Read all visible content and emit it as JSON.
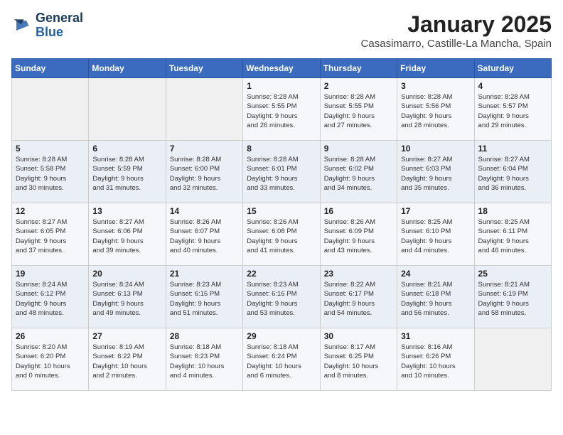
{
  "logo": {
    "line1": "General",
    "line2": "Blue"
  },
  "title": "January 2025",
  "location": "Casasimarro, Castille-La Mancha, Spain",
  "days_of_week": [
    "Sunday",
    "Monday",
    "Tuesday",
    "Wednesday",
    "Thursday",
    "Friday",
    "Saturday"
  ],
  "weeks": [
    [
      {
        "day": "",
        "info": ""
      },
      {
        "day": "",
        "info": ""
      },
      {
        "day": "",
        "info": ""
      },
      {
        "day": "1",
        "info": "Sunrise: 8:28 AM\nSunset: 5:55 PM\nDaylight: 9 hours\nand 26 minutes."
      },
      {
        "day": "2",
        "info": "Sunrise: 8:28 AM\nSunset: 5:55 PM\nDaylight: 9 hours\nand 27 minutes."
      },
      {
        "day": "3",
        "info": "Sunrise: 8:28 AM\nSunset: 5:56 PM\nDaylight: 9 hours\nand 28 minutes."
      },
      {
        "day": "4",
        "info": "Sunrise: 8:28 AM\nSunset: 5:57 PM\nDaylight: 9 hours\nand 29 minutes."
      }
    ],
    [
      {
        "day": "5",
        "info": "Sunrise: 8:28 AM\nSunset: 5:58 PM\nDaylight: 9 hours\nand 30 minutes."
      },
      {
        "day": "6",
        "info": "Sunrise: 8:28 AM\nSunset: 5:59 PM\nDaylight: 9 hours\nand 31 minutes."
      },
      {
        "day": "7",
        "info": "Sunrise: 8:28 AM\nSunset: 6:00 PM\nDaylight: 9 hours\nand 32 minutes."
      },
      {
        "day": "8",
        "info": "Sunrise: 8:28 AM\nSunset: 6:01 PM\nDaylight: 9 hours\nand 33 minutes."
      },
      {
        "day": "9",
        "info": "Sunrise: 8:28 AM\nSunset: 6:02 PM\nDaylight: 9 hours\nand 34 minutes."
      },
      {
        "day": "10",
        "info": "Sunrise: 8:27 AM\nSunset: 6:03 PM\nDaylight: 9 hours\nand 35 minutes."
      },
      {
        "day": "11",
        "info": "Sunrise: 8:27 AM\nSunset: 6:04 PM\nDaylight: 9 hours\nand 36 minutes."
      }
    ],
    [
      {
        "day": "12",
        "info": "Sunrise: 8:27 AM\nSunset: 6:05 PM\nDaylight: 9 hours\nand 37 minutes."
      },
      {
        "day": "13",
        "info": "Sunrise: 8:27 AM\nSunset: 6:06 PM\nDaylight: 9 hours\nand 39 minutes."
      },
      {
        "day": "14",
        "info": "Sunrise: 8:26 AM\nSunset: 6:07 PM\nDaylight: 9 hours\nand 40 minutes."
      },
      {
        "day": "15",
        "info": "Sunrise: 8:26 AM\nSunset: 6:08 PM\nDaylight: 9 hours\nand 41 minutes."
      },
      {
        "day": "16",
        "info": "Sunrise: 8:26 AM\nSunset: 6:09 PM\nDaylight: 9 hours\nand 43 minutes."
      },
      {
        "day": "17",
        "info": "Sunrise: 8:25 AM\nSunset: 6:10 PM\nDaylight: 9 hours\nand 44 minutes."
      },
      {
        "day": "18",
        "info": "Sunrise: 8:25 AM\nSunset: 6:11 PM\nDaylight: 9 hours\nand 46 minutes."
      }
    ],
    [
      {
        "day": "19",
        "info": "Sunrise: 8:24 AM\nSunset: 6:12 PM\nDaylight: 9 hours\nand 48 minutes."
      },
      {
        "day": "20",
        "info": "Sunrise: 8:24 AM\nSunset: 6:13 PM\nDaylight: 9 hours\nand 49 minutes."
      },
      {
        "day": "21",
        "info": "Sunrise: 8:23 AM\nSunset: 6:15 PM\nDaylight: 9 hours\nand 51 minutes."
      },
      {
        "day": "22",
        "info": "Sunrise: 8:23 AM\nSunset: 6:16 PM\nDaylight: 9 hours\nand 53 minutes."
      },
      {
        "day": "23",
        "info": "Sunrise: 8:22 AM\nSunset: 6:17 PM\nDaylight: 9 hours\nand 54 minutes."
      },
      {
        "day": "24",
        "info": "Sunrise: 8:21 AM\nSunset: 6:18 PM\nDaylight: 9 hours\nand 56 minutes."
      },
      {
        "day": "25",
        "info": "Sunrise: 8:21 AM\nSunset: 6:19 PM\nDaylight: 9 hours\nand 58 minutes."
      }
    ],
    [
      {
        "day": "26",
        "info": "Sunrise: 8:20 AM\nSunset: 6:20 PM\nDaylight: 10 hours\nand 0 minutes."
      },
      {
        "day": "27",
        "info": "Sunrise: 8:19 AM\nSunset: 6:22 PM\nDaylight: 10 hours\nand 2 minutes."
      },
      {
        "day": "28",
        "info": "Sunrise: 8:18 AM\nSunset: 6:23 PM\nDaylight: 10 hours\nand 4 minutes."
      },
      {
        "day": "29",
        "info": "Sunrise: 8:18 AM\nSunset: 6:24 PM\nDaylight: 10 hours\nand 6 minutes."
      },
      {
        "day": "30",
        "info": "Sunrise: 8:17 AM\nSunset: 6:25 PM\nDaylight: 10 hours\nand 8 minutes."
      },
      {
        "day": "31",
        "info": "Sunrise: 8:16 AM\nSunset: 6:26 PM\nDaylight: 10 hours\nand 10 minutes."
      },
      {
        "day": "",
        "info": ""
      }
    ]
  ]
}
